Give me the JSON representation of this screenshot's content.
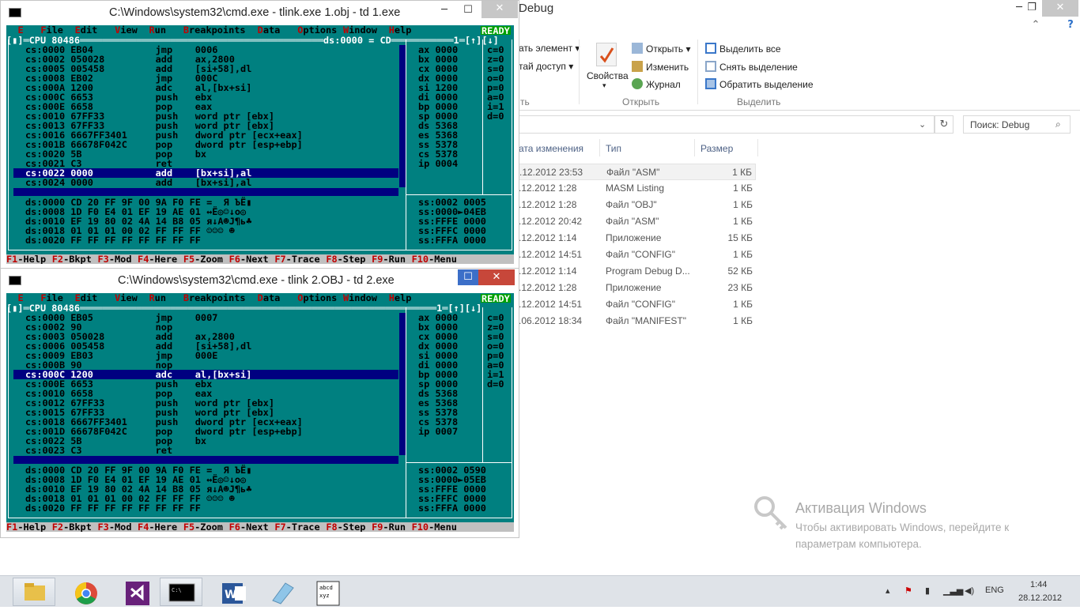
{
  "explorer": {
    "title": "Debug",
    "ribbon": {
      "new_item": "ать элемент ▾",
      "easy_access": "тай доступ ▾",
      "properties": "Свойства",
      "open": "Открыть ▾",
      "edit": "Изменить",
      "history": "Журнал",
      "group_open": "Открыть",
      "select_all": "Выделить все",
      "select_none": "Снять выделение",
      "invert": "Обратить выделение",
      "group_select": "Выделить",
      "group_partial": "ть"
    },
    "search_placeholder": "Поиск: Debug",
    "columns": {
      "date": "ата изменения",
      "type": "Тип",
      "size": "Размер"
    },
    "files": [
      {
        "date": ".12.2012 23:53",
        "type": "Файл \"ASM\"",
        "size": "1 КБ"
      },
      {
        "date": ".12.2012 1:28",
        "type": "MASM Listing",
        "size": "1 КБ"
      },
      {
        "date": ".12.2012 1:28",
        "type": "Файл \"OBJ\"",
        "size": "1 КБ"
      },
      {
        "date": ".12.2012 20:42",
        "type": "Файл \"ASM\"",
        "size": "1 КБ"
      },
      {
        "date": ".12.2012 1:14",
        "type": "Приложение",
        "size": "15 КБ"
      },
      {
        "date": ".12.2012 14:51",
        "type": "Файл \"CONFIG\"",
        "size": "1 КБ"
      },
      {
        "date": ".12.2012 1:14",
        "type": "Program Debug D...",
        "size": "52 КБ"
      },
      {
        "date": ".12.2012 1:28",
        "type": "Приложение",
        "size": "23 КБ"
      },
      {
        "date": ".12.2012 14:51",
        "type": "Файл \"CONFIG\"",
        "size": "1 КБ"
      },
      {
        "date": ".06.2012 18:34",
        "type": "Файл \"MANIFEST\"",
        "size": "1 КБ"
      }
    ],
    "watermark_title": "Активация Windows",
    "watermark_text": "Чтобы активировать Windows, перейдите к параметрам компьютера."
  },
  "cmd_windows": [
    {
      "title": "C:\\Windows\\system32\\cmd.exe - tlink.exe  1.obj - td 1.exe",
      "cpu_header": "[▮]═CPU 80486═══════════════════════════════════════════ds:0000 = CD═══════════1═[↑][↓]",
      "code": [
        "cs:0000 EB04           jmp    0006",
        "cs:0002 050028         add    ax,2800",
        "cs:0005 005458         add    [si+58],dl",
        "cs:0008 EB02           jmp    000C",
        "cs:000A 1200           adc    al,[bx+si]",
        "cs:000C 6653           push   ebx",
        "cs:000E 6658           pop    eax",
        "cs:0010 67FF33         push   word ptr [ebx]",
        "cs:0013 67FF33         push   word ptr [ebx]",
        "cs:0016 6667FF3401     push   dword ptr [ecx+eax]",
        "cs:001B 66678F042C     pop    dword ptr [esp+ebp]",
        "cs:0020 5B             pop    bx",
        "cs:0021 C3             ret",
        "cs:0022 0000           add    [bx+si],al",
        "cs:0024 0000           add    [bx+si],al"
      ],
      "selected_row": 13,
      "regs": [
        "ax 0000",
        "bx 0000",
        "cx 0000",
        "dx 0000",
        "si 1200",
        "di 0000",
        "bp 0000",
        "sp 0000",
        "ds 5368",
        "es 5368",
        "ss 5378",
        "cs 5378",
        "ip 0004"
      ],
      "flags": [
        "c=0",
        "z=0",
        "s=0",
        "o=0",
        "p=0",
        "a=0",
        "i=1",
        "d=0"
      ],
      "dump": [
        "ds:0000 CD 20 FF 9F 00 9A F0 FE =  Я ЪЁ▮",
        "ds:0008 1D F0 E4 01 EF 19 AE 01 ↔Ё◎☺↓o◎",
        "ds:0010 EF 19 80 02 4A 14 B8 05 я↓А☻J¶ь♣",
        "ds:0018 01 01 01 00 02 FF FF FF ☺☺☺ ☻",
        "ds:0020 FF FF FF FF FF FF FF FF"
      ],
      "stack": [
        "ss:0002 0005",
        "ss:0000►04EB",
        "ss:FFFE 0000",
        "ss:FFFC 0000",
        "ss:FFFA 0000"
      ]
    },
    {
      "title": "C:\\Windows\\system32\\cmd.exe - tlink  2.OBJ - td 2.exe",
      "cpu_header": "[▮]═CPU 80486═══════════════════════════════════════════════════════════════1═[↑][↓]",
      "code": [
        "cs:0000 EB05           jmp    0007",
        "cs:0002 90             nop",
        "cs:0003 050028         add    ax,2800",
        "cs:0006 005458         add    [si+58],dl",
        "cs:0009 EB03           jmp    000E",
        "cs:000B 90             nop",
        "cs:000C 1200           adc    al,[bx+si]",
        "cs:000E 6653           push   ebx",
        "cs:0010 6658           pop    eax",
        "cs:0012 67FF33         push   word ptr [ebx]",
        "cs:0015 67FF33         push   word ptr [ebx]",
        "cs:0018 6667FF3401     push   dword ptr [ecx+eax]",
        "cs:001D 66678F042C     pop    dword ptr [esp+ebp]",
        "cs:0022 5B             pop    bx",
        "cs:0023 C3             ret"
      ],
      "selected_row": 6,
      "regs": [
        "ax 0000",
        "bx 0000",
        "cx 0000",
        "dx 0000",
        "si 0000",
        "di 0000",
        "bp 0000",
        "sp 0000",
        "ds 5368",
        "es 5368",
        "ss 5378",
        "cs 5378",
        "ip 0007"
      ],
      "flags": [
        "c=0",
        "z=0",
        "s=0",
        "o=0",
        "p=0",
        "a=0",
        "i=1",
        "d=0"
      ],
      "dump": [
        "ds:0000 CD 20 FF 9F 00 9A F0 FE =  Я ЪЁ▮",
        "ds:0008 1D F0 E4 01 EF 19 AE 01 ↔Ё◎☺↓o◎",
        "ds:0010 EF 19 80 02 4A 14 B8 05 я↓А☻J¶ь♣",
        "ds:0018 01 01 01 00 02 FF FF FF ☺☺☺ ☻",
        "ds:0020 FF FF FF FF FF FF FF FF"
      ],
      "stack": [
        "ss:0002 0590",
        "ss:0000►05EB",
        "ss:FFFE 0000",
        "ss:FFFC 0000",
        "ss:FFFA 0000"
      ]
    }
  ],
  "td_menu": [
    "E",
    "File",
    "Edit",
    "View",
    "Run",
    "Breakpoints",
    "Data",
    "Options",
    "Window",
    "Help"
  ],
  "td_status": "READY",
  "fkeys": [
    {
      "k": "F1",
      "l": "-Help"
    },
    {
      "k": "F2",
      "l": "-Bkpt"
    },
    {
      "k": "F3",
      "l": "-Mod"
    },
    {
      "k": "F4",
      "l": "-Here"
    },
    {
      "k": "F5",
      "l": "-Zoom"
    },
    {
      "k": "F6",
      "l": "-Next"
    },
    {
      "k": "F7",
      "l": "-Trace"
    },
    {
      "k": "F8",
      "l": "-Step"
    },
    {
      "k": "F9",
      "l": "-Run"
    },
    {
      "k": "F10",
      "l": "-Menu"
    }
  ],
  "taskbar": {
    "lang": "ENG",
    "time": "1:44",
    "date": "28.12.2012"
  }
}
